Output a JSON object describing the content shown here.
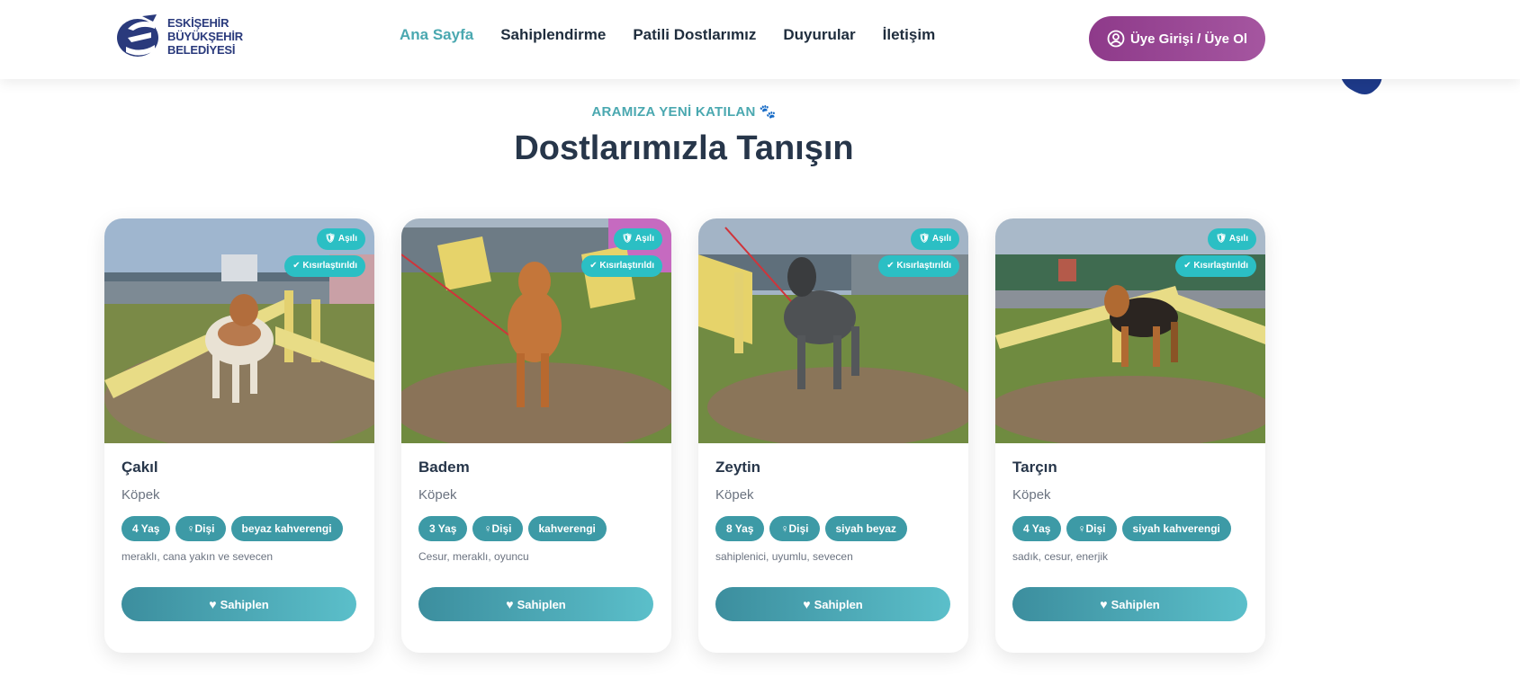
{
  "header": {
    "logo_lines": [
      "ESKİŞEHİR",
      "BÜYÜKŞEHİR",
      "BELEDİYESİ"
    ],
    "nav": [
      {
        "label": "Ana Sayfa",
        "active": true
      },
      {
        "label": "Sahiplendirme",
        "active": false
      },
      {
        "label": "Patili Dostlarımız",
        "active": false
      },
      {
        "label": "Duyurular",
        "active": false
      },
      {
        "label": "İletişim",
        "active": false
      }
    ],
    "login_label": "Üye Girişi / Üye Ol"
  },
  "section": {
    "eyebrow": "ARAMIZA YENİ KATILAN",
    "title": "Dostlarımızla Tanışın"
  },
  "cards": [
    {
      "name": "Çakıl",
      "type": "Köpek",
      "age": "4 Yaş",
      "gender": "Dişi",
      "color": "beyaz kahverengi",
      "traits": "meraklı, cana yakın ve sevecen",
      "tag_vaccinated": "Aşılı",
      "tag_neutered": "Kısırlaştırıldı",
      "adopt_label": "Sahiplen"
    },
    {
      "name": "Badem",
      "type": "Köpek",
      "age": "3 Yaş",
      "gender": "Dişi",
      "color": "kahverengi",
      "traits": "Cesur, meraklı, oyuncu",
      "tag_vaccinated": "Aşılı",
      "tag_neutered": "Kısırlaştırıldı",
      "adopt_label": "Sahiplen"
    },
    {
      "name": "Zeytin",
      "type": "Köpek",
      "age": "8 Yaş",
      "gender": "Dişi",
      "color": "siyah beyaz",
      "traits": "sahiplenici, uyumlu, sevecen",
      "tag_vaccinated": "Aşılı",
      "tag_neutered": "Kısırlaştırıldı",
      "adopt_label": "Sahiplen"
    },
    {
      "name": "Tarçın",
      "type": "Köpek",
      "age": "4 Yaş",
      "gender": "Dişi",
      "color": "siyah kahverengi",
      "traits": "sadık, cesur, enerjik",
      "tag_vaccinated": "Aşılı",
      "tag_neutered": "Kısırlaştırıldı",
      "adopt_label": "Sahiplen"
    }
  ],
  "colors": {
    "accent_teal": "#4aa8b0",
    "login_purple": "#8e3a8a",
    "chip_teal": "#3d9aa6",
    "tag_cyan": "#2bbfc4",
    "heading_dark": "#27364a"
  }
}
